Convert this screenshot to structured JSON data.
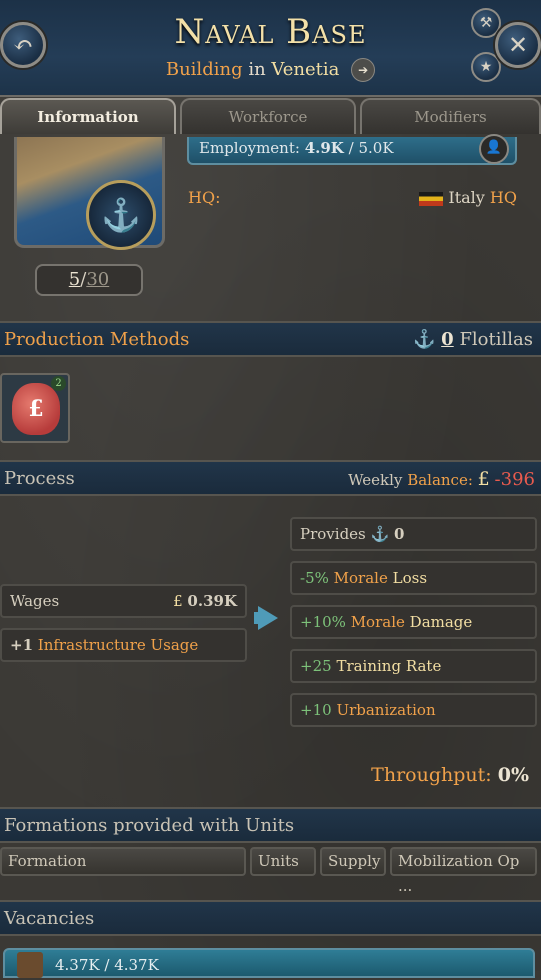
{
  "header": {
    "title": "Naval Base",
    "subtitle_type": "Building",
    "subtitle_in": "in",
    "subtitle_location": "Venetia",
    "back_icon": "back-arrow-icon",
    "close_icon": "close-icon",
    "tool_icon": "hammer-icon",
    "star_icon": "star-icon"
  },
  "tabs": [
    {
      "label": "Information",
      "active": true
    },
    {
      "label": "Workforce",
      "active": false
    },
    {
      "label": "Modifiers",
      "active": false
    }
  ],
  "info": {
    "level_current": "5",
    "level_sep": "/",
    "level_max": "30",
    "employment_label": "Employment:",
    "employment_current": "4.9K",
    "employment_sep": "/",
    "employment_max": "5.0K",
    "hq_label": "HQ:",
    "hq_country": "Italy",
    "hq_suffix": "HQ"
  },
  "production": {
    "title": "Production Methods",
    "flotillas_count": "0",
    "flotillas_label": "Flotillas",
    "method_badge": "2",
    "method_icon_glyph": "£"
  },
  "process": {
    "title": "Process",
    "weekly_label": "Weekly",
    "balance_label": "Balance:",
    "currency": "£",
    "balance_value": "-396",
    "inputs": [
      {
        "label": "Wages",
        "currency": "£",
        "value": "0.39K"
      },
      {
        "value": "+1",
        "label": "Infrastructure Usage"
      }
    ],
    "provides_label": "Provides",
    "provides_value": "0",
    "outputs": [
      {
        "value": "-5%",
        "key": "Morale",
        "rest": "Loss"
      },
      {
        "value": "+10%",
        "key": "Morale",
        "rest": "Damage"
      },
      {
        "value": "+25",
        "key": "",
        "rest": "Training Rate"
      },
      {
        "value": "+10",
        "key": "Urbanization",
        "rest": ""
      }
    ],
    "throughput_label": "Throughput:",
    "throughput_value": "0%"
  },
  "formations": {
    "title": "Formations provided with Units",
    "columns": [
      "Formation",
      "Units",
      "Supply",
      "Mobilization Op ..."
    ]
  },
  "vacancies": {
    "title": "Vacancies",
    "value": "4.37K / 4.37K"
  }
}
